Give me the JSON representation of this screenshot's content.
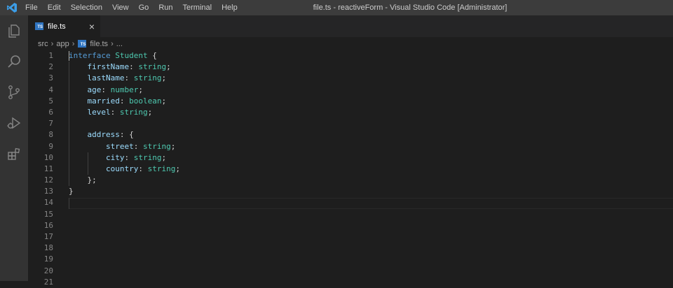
{
  "titlebar": {
    "menu": [
      "File",
      "Edit",
      "Selection",
      "View",
      "Go",
      "Run",
      "Terminal",
      "Help"
    ],
    "title": "file.ts - reactiveForm - Visual Studio Code [Administrator]"
  },
  "activity": [
    "explorer-icon",
    "search-icon",
    "source-control-icon",
    "run-debug-icon",
    "extensions-icon"
  ],
  "tab": {
    "badge": "TS",
    "label": "file.ts",
    "close": "×"
  },
  "breadcrumb": {
    "items": [
      "src",
      "app"
    ],
    "file": "file.ts",
    "more": "...",
    "badge": "TS"
  },
  "editor": {
    "line_numbers": [
      "1",
      "2",
      "3",
      "4",
      "5",
      "6",
      "7",
      "8",
      "9",
      "10",
      "11",
      "12",
      "13",
      "14",
      "15",
      "16",
      "17",
      "18",
      "19",
      "20",
      "21"
    ],
    "lines": [
      [
        [
          "kw",
          "interface"
        ],
        [
          "p",
          " "
        ],
        [
          "ty",
          "Student"
        ],
        [
          "p",
          " {"
        ]
      ],
      [
        [
          "p",
          "    "
        ],
        [
          "pr",
          "firstName"
        ],
        [
          "p",
          ": "
        ],
        [
          "ty",
          "string"
        ],
        [
          "p",
          ";"
        ]
      ],
      [
        [
          "p",
          "    "
        ],
        [
          "pr",
          "lastName"
        ],
        [
          "p",
          ": "
        ],
        [
          "ty",
          "string"
        ],
        [
          "p",
          ";"
        ]
      ],
      [
        [
          "p",
          "    "
        ],
        [
          "pr",
          "age"
        ],
        [
          "p",
          ": "
        ],
        [
          "ty",
          "number"
        ],
        [
          "p",
          ";"
        ]
      ],
      [
        [
          "p",
          "    "
        ],
        [
          "pr",
          "married"
        ],
        [
          "p",
          ": "
        ],
        [
          "ty",
          "boolean"
        ],
        [
          "p",
          ";"
        ]
      ],
      [
        [
          "p",
          "    "
        ],
        [
          "pr",
          "level"
        ],
        [
          "p",
          ": "
        ],
        [
          "ty",
          "string"
        ],
        [
          "p",
          ";"
        ]
      ],
      [
        [
          "p",
          ""
        ]
      ],
      [
        [
          "p",
          "    "
        ],
        [
          "pr",
          "address"
        ],
        [
          "p",
          ": {"
        ]
      ],
      [
        [
          "p",
          "        "
        ],
        [
          "pr",
          "street"
        ],
        [
          "p",
          ": "
        ],
        [
          "ty",
          "string"
        ],
        [
          "p",
          ";"
        ]
      ],
      [
        [
          "p",
          "        "
        ],
        [
          "pr",
          "city"
        ],
        [
          "p",
          ": "
        ],
        [
          "ty",
          "string"
        ],
        [
          "p",
          ";"
        ]
      ],
      [
        [
          "p",
          "        "
        ],
        [
          "pr",
          "country"
        ],
        [
          "p",
          ": "
        ],
        [
          "ty",
          "string"
        ],
        [
          "p",
          ";"
        ]
      ],
      [
        [
          "p",
          "    };"
        ]
      ],
      [
        [
          "p",
          "}"
        ]
      ]
    ]
  }
}
